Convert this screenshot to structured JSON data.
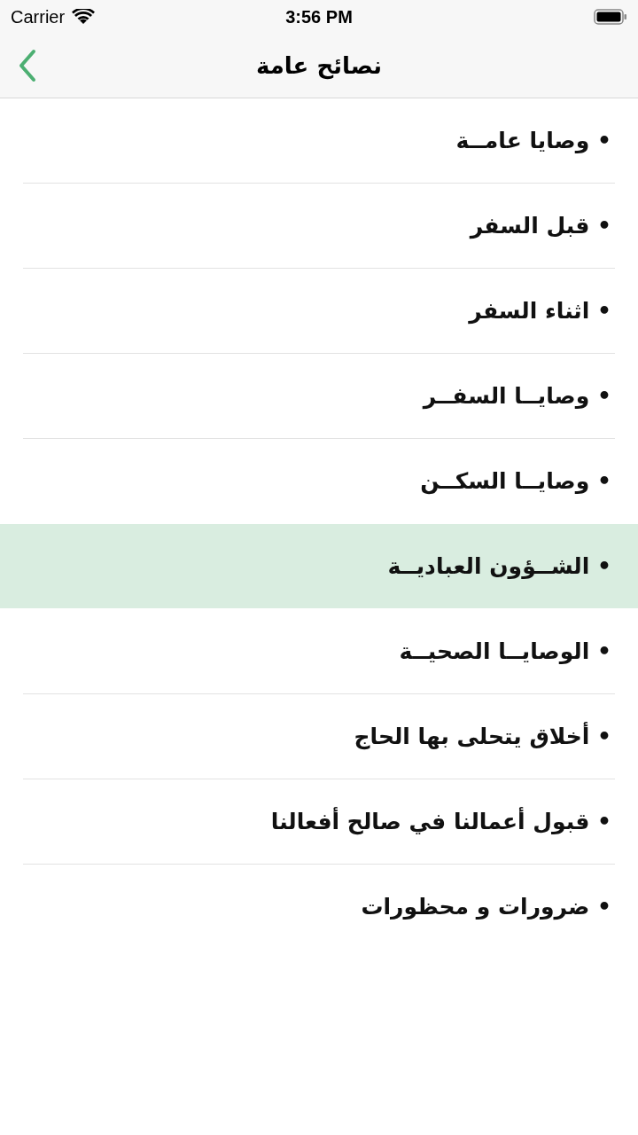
{
  "status_bar": {
    "carrier": "Carrier",
    "time": "3:56 PM"
  },
  "nav_bar": {
    "title": "نصائح عامة"
  },
  "items": [
    {
      "label": "• وصايا عامــة",
      "selected": false
    },
    {
      "label": "• قبل السفر",
      "selected": false
    },
    {
      "label": "• اثناء السفر",
      "selected": false
    },
    {
      "label": "• وصايــا السفــر",
      "selected": false
    },
    {
      "label": "• وصايــا السكــن",
      "selected": false
    },
    {
      "label": "• الشــؤون العباديــة",
      "selected": true
    },
    {
      "label": "• الوصايــا الصحيــة",
      "selected": false
    },
    {
      "label": "• أخلاق يتحلى بها الحاج",
      "selected": false
    },
    {
      "label": "• قبول أعمالنا في صالح أفعالنا",
      "selected": false
    },
    {
      "label": "• ضرورات و محظورات",
      "selected": false
    }
  ]
}
